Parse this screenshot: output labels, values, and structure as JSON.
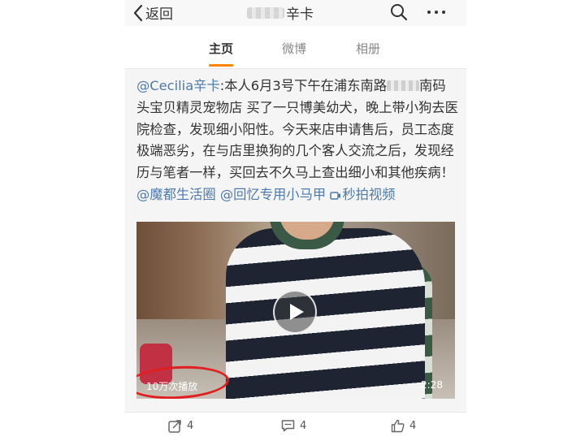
{
  "nav": {
    "back_label": "返回",
    "title_suffix": "辛卡"
  },
  "tabs": [
    {
      "label": "主页",
      "active": true
    },
    {
      "label": "微博",
      "active": false
    },
    {
      "label": "相册",
      "active": false
    }
  ],
  "post": {
    "author_mention": "@Cecilia辛卡",
    "text_1": ":本人6月3号下午在浦东南路",
    "text_2": "南码头宝贝精灵宠物店 买了一只博美幼犬，晚上带小狗去医院检查，发现细小阳性。今天来店申请售后，员工态度极端恶劣，在与店里换狗的几个客人交流之后，发现经历与笔者一样，买回去不久马上查出细小和其他疾病！",
    "mention_1": "@魔都生活圈",
    "mention_2": "@回忆专用小马甲",
    "video_link": "秒拍视频"
  },
  "video": {
    "views": "10万次播放",
    "duration": "2:28"
  },
  "actions": {
    "repost_count": "4",
    "comment_count": "4",
    "like_count": "4"
  },
  "colors": {
    "accent": "#ff8200",
    "link": "#4d7aad",
    "annotation_circle": "#e02020"
  }
}
